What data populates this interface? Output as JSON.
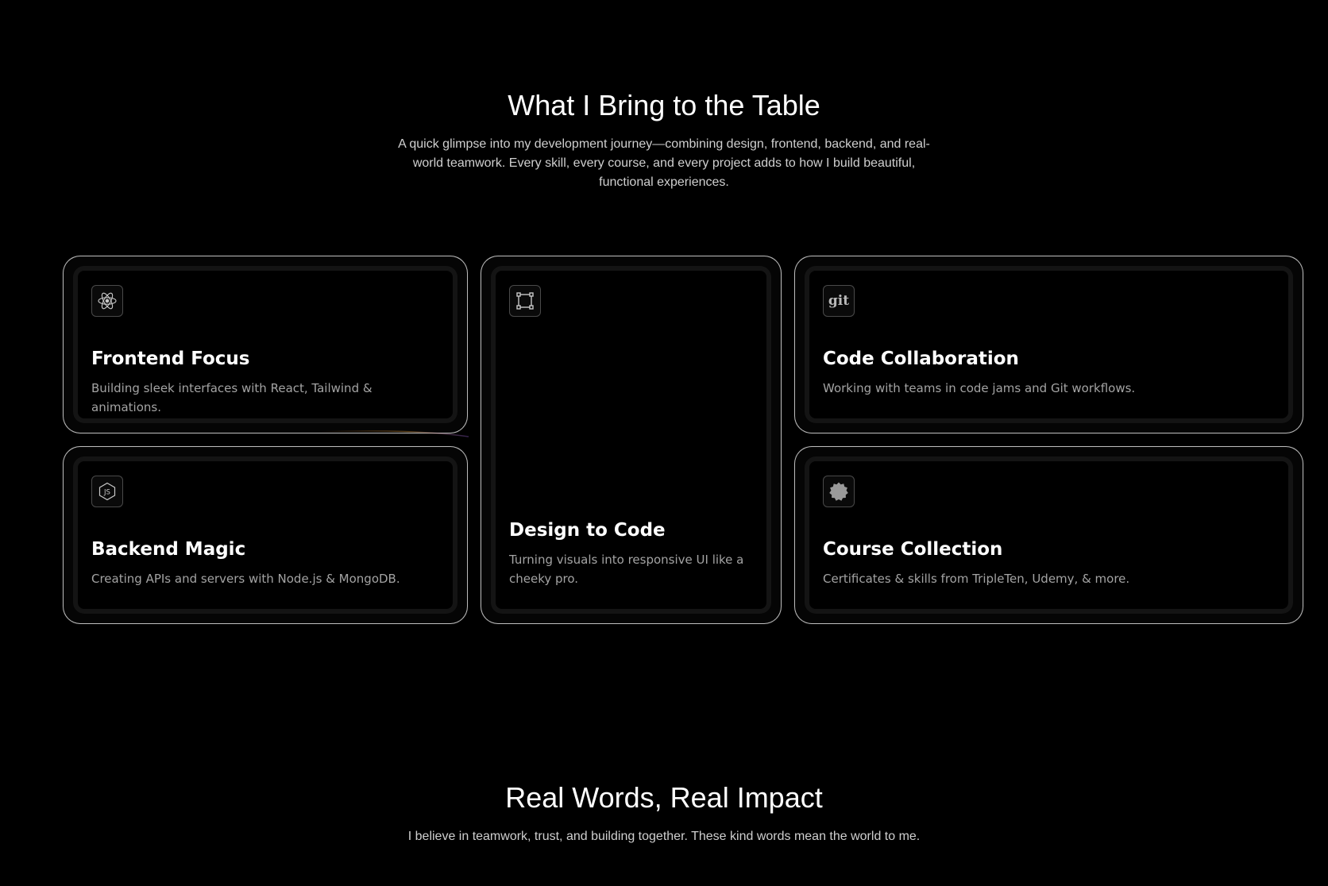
{
  "skills_section": {
    "title": "What I Bring to the Table",
    "subtitle": "A quick glimpse into my development journey—combining design, frontend, backend, and real-world teamwork. Every skill, every course, and every project adds to how I build beautiful, functional experiences."
  },
  "cards": [
    {
      "title": "Frontend Focus",
      "description": "Building sleek interfaces with React, Tailwind & animations.",
      "icon": "react-icon"
    },
    {
      "title": "Design to Code",
      "description": "Turning visuals into responsive UI like a cheeky pro.",
      "icon": "frame-icon"
    },
    {
      "title": "Code Collaboration",
      "description": "Working with teams in code jams and Git workflows.",
      "icon": "git-icon",
      "icon_text": "git"
    },
    {
      "title": "Backend Magic",
      "description": "Creating APIs and servers with Node.js & MongoDB.",
      "icon": "nodejs-icon"
    },
    {
      "title": "Course Collection",
      "description": "Certificates & skills from TripleTen, Udemy, & more.",
      "icon": "badge-icon"
    }
  ],
  "testimonials_section": {
    "title": "Real Words, Real Impact",
    "subtitle": "I believe in teamwork, trust, and building together. These kind words mean the world to me."
  },
  "colors": {
    "background": "#000000",
    "card_border": "#dcdcdc",
    "text_primary": "#ffffff",
    "text_secondary": "#a3a3a3"
  }
}
